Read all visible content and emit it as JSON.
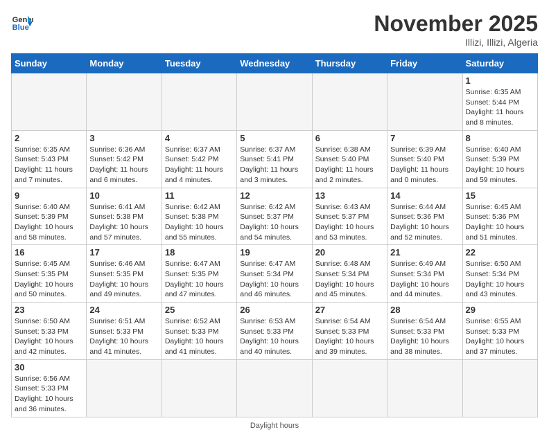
{
  "header": {
    "logo_general": "General",
    "logo_blue": "Blue",
    "month_title": "November 2025",
    "location": "Illizi, Illizi, Algeria"
  },
  "days_of_week": [
    "Sunday",
    "Monday",
    "Tuesday",
    "Wednesday",
    "Thursday",
    "Friday",
    "Saturday"
  ],
  "weeks": [
    [
      {
        "day": "",
        "info": ""
      },
      {
        "day": "",
        "info": ""
      },
      {
        "day": "",
        "info": ""
      },
      {
        "day": "",
        "info": ""
      },
      {
        "day": "",
        "info": ""
      },
      {
        "day": "",
        "info": ""
      },
      {
        "day": "1",
        "info": "Sunrise: 6:35 AM\nSunset: 5:44 PM\nDaylight: 11 hours and 8 minutes."
      }
    ],
    [
      {
        "day": "2",
        "info": "Sunrise: 6:35 AM\nSunset: 5:43 PM\nDaylight: 11 hours and 7 minutes."
      },
      {
        "day": "3",
        "info": "Sunrise: 6:36 AM\nSunset: 5:42 PM\nDaylight: 11 hours and 6 minutes."
      },
      {
        "day": "4",
        "info": "Sunrise: 6:37 AM\nSunset: 5:42 PM\nDaylight: 11 hours and 4 minutes."
      },
      {
        "day": "5",
        "info": "Sunrise: 6:37 AM\nSunset: 5:41 PM\nDaylight: 11 hours and 3 minutes."
      },
      {
        "day": "6",
        "info": "Sunrise: 6:38 AM\nSunset: 5:40 PM\nDaylight: 11 hours and 2 minutes."
      },
      {
        "day": "7",
        "info": "Sunrise: 6:39 AM\nSunset: 5:40 PM\nDaylight: 11 hours and 0 minutes."
      },
      {
        "day": "8",
        "info": "Sunrise: 6:40 AM\nSunset: 5:39 PM\nDaylight: 10 hours and 59 minutes."
      }
    ],
    [
      {
        "day": "9",
        "info": "Sunrise: 6:40 AM\nSunset: 5:39 PM\nDaylight: 10 hours and 58 minutes."
      },
      {
        "day": "10",
        "info": "Sunrise: 6:41 AM\nSunset: 5:38 PM\nDaylight: 10 hours and 57 minutes."
      },
      {
        "day": "11",
        "info": "Sunrise: 6:42 AM\nSunset: 5:38 PM\nDaylight: 10 hours and 55 minutes."
      },
      {
        "day": "12",
        "info": "Sunrise: 6:42 AM\nSunset: 5:37 PM\nDaylight: 10 hours and 54 minutes."
      },
      {
        "day": "13",
        "info": "Sunrise: 6:43 AM\nSunset: 5:37 PM\nDaylight: 10 hours and 53 minutes."
      },
      {
        "day": "14",
        "info": "Sunrise: 6:44 AM\nSunset: 5:36 PM\nDaylight: 10 hours and 52 minutes."
      },
      {
        "day": "15",
        "info": "Sunrise: 6:45 AM\nSunset: 5:36 PM\nDaylight: 10 hours and 51 minutes."
      }
    ],
    [
      {
        "day": "16",
        "info": "Sunrise: 6:45 AM\nSunset: 5:35 PM\nDaylight: 10 hours and 50 minutes."
      },
      {
        "day": "17",
        "info": "Sunrise: 6:46 AM\nSunset: 5:35 PM\nDaylight: 10 hours and 49 minutes."
      },
      {
        "day": "18",
        "info": "Sunrise: 6:47 AM\nSunset: 5:35 PM\nDaylight: 10 hours and 47 minutes."
      },
      {
        "day": "19",
        "info": "Sunrise: 6:47 AM\nSunset: 5:34 PM\nDaylight: 10 hours and 46 minutes."
      },
      {
        "day": "20",
        "info": "Sunrise: 6:48 AM\nSunset: 5:34 PM\nDaylight: 10 hours and 45 minutes."
      },
      {
        "day": "21",
        "info": "Sunrise: 6:49 AM\nSunset: 5:34 PM\nDaylight: 10 hours and 44 minutes."
      },
      {
        "day": "22",
        "info": "Sunrise: 6:50 AM\nSunset: 5:34 PM\nDaylight: 10 hours and 43 minutes."
      }
    ],
    [
      {
        "day": "23",
        "info": "Sunrise: 6:50 AM\nSunset: 5:33 PM\nDaylight: 10 hours and 42 minutes."
      },
      {
        "day": "24",
        "info": "Sunrise: 6:51 AM\nSunset: 5:33 PM\nDaylight: 10 hours and 41 minutes."
      },
      {
        "day": "25",
        "info": "Sunrise: 6:52 AM\nSunset: 5:33 PM\nDaylight: 10 hours and 41 minutes."
      },
      {
        "day": "26",
        "info": "Sunrise: 6:53 AM\nSunset: 5:33 PM\nDaylight: 10 hours and 40 minutes."
      },
      {
        "day": "27",
        "info": "Sunrise: 6:54 AM\nSunset: 5:33 PM\nDaylight: 10 hours and 39 minutes."
      },
      {
        "day": "28",
        "info": "Sunrise: 6:54 AM\nSunset: 5:33 PM\nDaylight: 10 hours and 38 minutes."
      },
      {
        "day": "29",
        "info": "Sunrise: 6:55 AM\nSunset: 5:33 PM\nDaylight: 10 hours and 37 minutes."
      }
    ],
    [
      {
        "day": "30",
        "info": "Sunrise: 6:56 AM\nSunset: 5:33 PM\nDaylight: 10 hours and 36 minutes."
      },
      {
        "day": "",
        "info": ""
      },
      {
        "day": "",
        "info": ""
      },
      {
        "day": "",
        "info": ""
      },
      {
        "day": "",
        "info": ""
      },
      {
        "day": "",
        "info": ""
      },
      {
        "day": "",
        "info": ""
      }
    ]
  ],
  "footer": {
    "text": "Daylight hours"
  }
}
